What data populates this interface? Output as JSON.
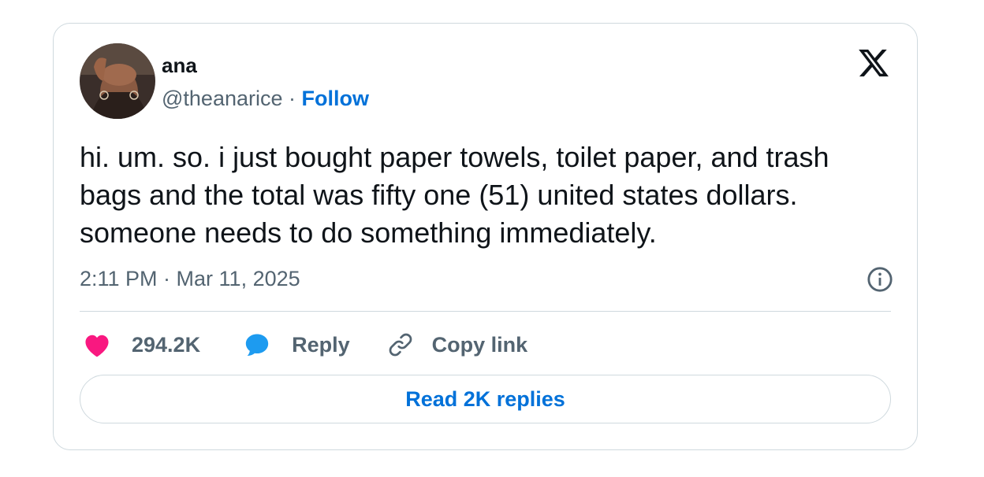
{
  "author": {
    "name": "ana",
    "handle": "@theanarice",
    "separator": "·",
    "follow_label": "Follow"
  },
  "tweet": {
    "text": "hi. um. so. i just bought paper towels, toilet paper, and trash bags and the total was fifty one (51) united states dollars. someone needs to do something immediately.",
    "timestamp": "2:11 PM · Mar 11, 2025"
  },
  "actions": {
    "likes_count": "294.2K",
    "reply_label": "Reply",
    "copy_link_label": "Copy link"
  },
  "read_replies_label": "Read 2K replies",
  "icons": {
    "platform_logo": "x-logo-icon",
    "info": "info-icon",
    "like": "heart-icon",
    "reply": "speech-bubble-icon",
    "copy": "link-icon"
  },
  "colors": {
    "accent_blue": "#0071d9",
    "like_pink": "#f91880",
    "reply_blue": "#1d9bf0",
    "muted_text": "#536471",
    "border": "#cfd9de"
  }
}
